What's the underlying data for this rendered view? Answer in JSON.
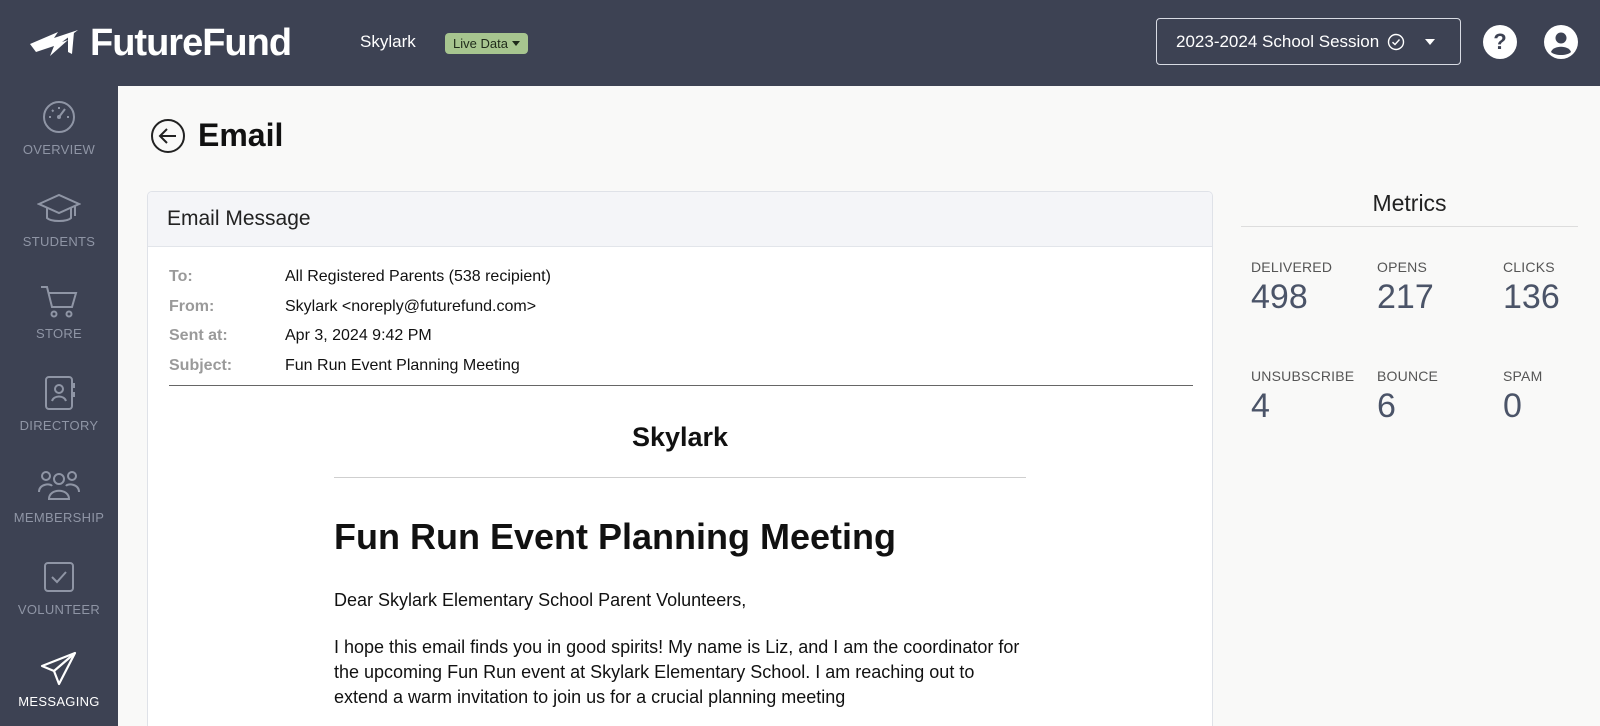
{
  "header": {
    "brand": "FutureFund",
    "org": "Skylark",
    "live_badge": "Live Data",
    "session": "2023-2024 School Session",
    "help": "?"
  },
  "sidebar": {
    "items": [
      {
        "label": "OVERVIEW",
        "icon": "gauge-icon"
      },
      {
        "label": "STUDENTS",
        "icon": "graduation-cap-icon"
      },
      {
        "label": "STORE",
        "icon": "cart-icon"
      },
      {
        "label": "DIRECTORY",
        "icon": "contact-book-icon"
      },
      {
        "label": "MEMBERSHIP",
        "icon": "users-icon"
      },
      {
        "label": "VOLUNTEER",
        "icon": "checkbox-icon"
      },
      {
        "label": "MESSAGING",
        "icon": "paper-plane-icon",
        "active": true
      }
    ]
  },
  "page": {
    "title": "Email"
  },
  "email_card": {
    "header": "Email Message",
    "meta": [
      {
        "key": "To:",
        "value": "All Registered Parents (538 recipient)"
      },
      {
        "key": "From:",
        "value": "Skylark <noreply@futurefund.com>"
      },
      {
        "key": "Sent at:",
        "value": "Apr 3, 2024 9:42 PM"
      },
      {
        "key": "Subject:",
        "value": "Fun Run Event Planning Meeting"
      }
    ],
    "body": {
      "org": "Skylark",
      "subject": "Fun Run Event Planning Meeting",
      "greeting": "Dear Skylark Elementary School Parent Volunteers,",
      "paragraph": "I hope this email finds you in good spirits! My name is Liz, and I am the coordinator for the upcoming Fun Run event at Skylark Elementary School. I am reaching out to extend a warm invitation to join us for a crucial planning meeting"
    }
  },
  "metrics": {
    "title": "Metrics",
    "items": [
      {
        "label": "DELIVERED",
        "value": "498"
      },
      {
        "label": "OPENS",
        "value": "217"
      },
      {
        "label": "CLICKS",
        "value": "136"
      },
      {
        "label": "UNSUBSCRIBE",
        "value": "4"
      },
      {
        "label": "BOUNCE",
        "value": "6"
      },
      {
        "label": "SPAM",
        "value": "0"
      }
    ]
  }
}
